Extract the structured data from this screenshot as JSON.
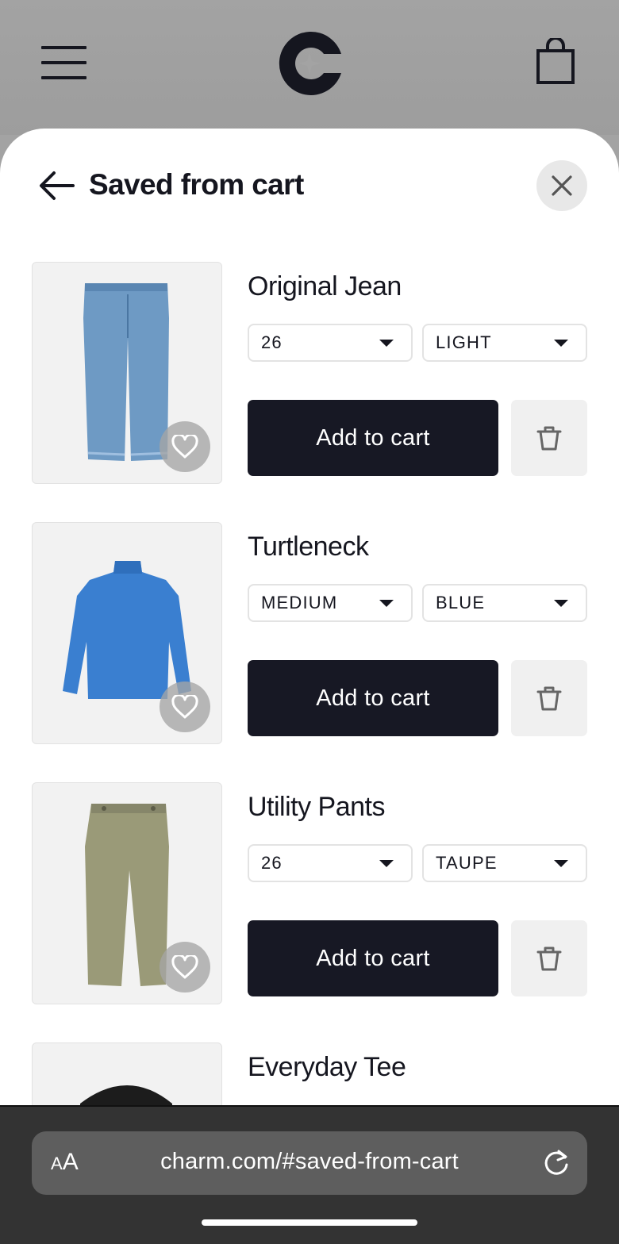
{
  "topbar": {
    "menu_icon": "hamburger-menu-icon",
    "logo_icon": "charm-logo",
    "cart_icon": "shopping-bag-icon"
  },
  "sheet": {
    "title": "Saved from cart",
    "back_icon": "arrow-left-icon",
    "close_icon": "close-icon"
  },
  "items": [
    {
      "name": "Original Jean",
      "size": "26",
      "color": "LIGHT",
      "add_label": "Add to cart",
      "product_color": "#6e9ac4"
    },
    {
      "name": "Turtleneck",
      "size": "MEDIUM",
      "color": "BLUE",
      "add_label": "Add to cart",
      "product_color": "#3a7fd0"
    },
    {
      "name": "Utility Pants",
      "size": "26",
      "color": "TAUPE",
      "add_label": "Add to cart",
      "product_color": "#9a9a78"
    },
    {
      "name": "Everyday Tee",
      "product_color": "#1c1c1c"
    }
  ],
  "browser": {
    "aa_label_small": "A",
    "aa_label_large": "A",
    "url": "charm.com/#saved-from-cart",
    "reload_icon": "reload-icon"
  },
  "colors": {
    "primary_button": "#171824",
    "overlay": "#a3a3a3"
  }
}
